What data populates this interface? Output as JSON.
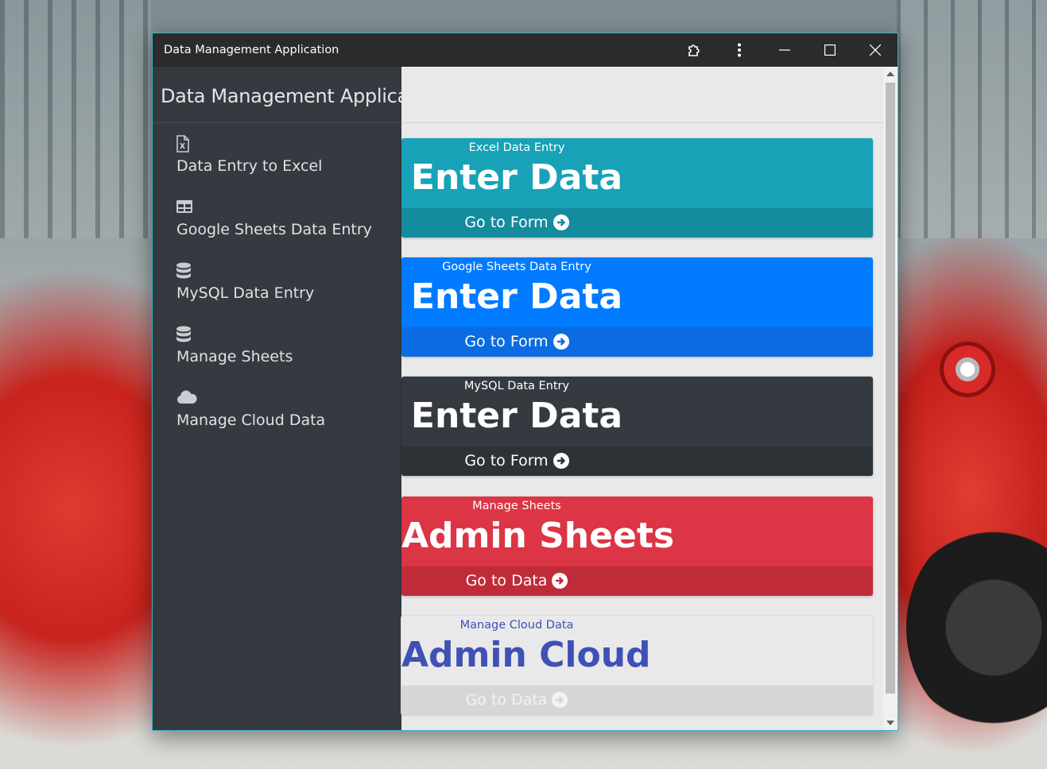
{
  "window": {
    "title": "Data Management Application"
  },
  "sidebar": {
    "brand": "Data Management Applica..",
    "items": [
      {
        "label": "Data Entry to Excel",
        "icon": "file-excel-icon"
      },
      {
        "label": "Google Sheets Data Entry",
        "icon": "table-icon"
      },
      {
        "label": "MySQL Data Entry",
        "icon": "database-icon"
      },
      {
        "label": "Manage Sheets",
        "icon": "database-icon"
      },
      {
        "label": "Manage Cloud Data",
        "icon": "cloud-icon"
      }
    ]
  },
  "cards": [
    {
      "subtitle": "Excel Data Entry",
      "title": "Enter Data",
      "action": "Go to Form",
      "bg": "#17a2b8",
      "footer_bg": "#158b9e",
      "text": "#ffffff"
    },
    {
      "subtitle": "Google Sheets Data Entry",
      "title": "Enter Data",
      "action": "Go to Form",
      "bg": "#007bff",
      "footer_bg": "#0a6ce0",
      "text": "#ffffff"
    },
    {
      "subtitle": "MySQL Data Entry",
      "title": "Enter Data",
      "action": "Go to Form",
      "bg": "#343a40",
      "footer_bg": "#2d3237",
      "text": "#ffffff"
    },
    {
      "subtitle": "Manage Sheets",
      "title": "Admin Sheets",
      "action": "Go to Data",
      "bg": "#dc3545",
      "footer_bg": "#c02b39",
      "text": "#ffffff"
    },
    {
      "subtitle": "Manage Cloud Data",
      "title": "Admin Cloud",
      "action": "Go to Data",
      "bg": "#e9e9ea",
      "footer_bg": "#d6d6d7",
      "text": "#3f51b5",
      "footer_text": "#f3f3f3"
    }
  ],
  "colors": {
    "window_border": "#3ab7c4",
    "titlebar": "#2b2b2b",
    "sidebar": "#343a40"
  }
}
